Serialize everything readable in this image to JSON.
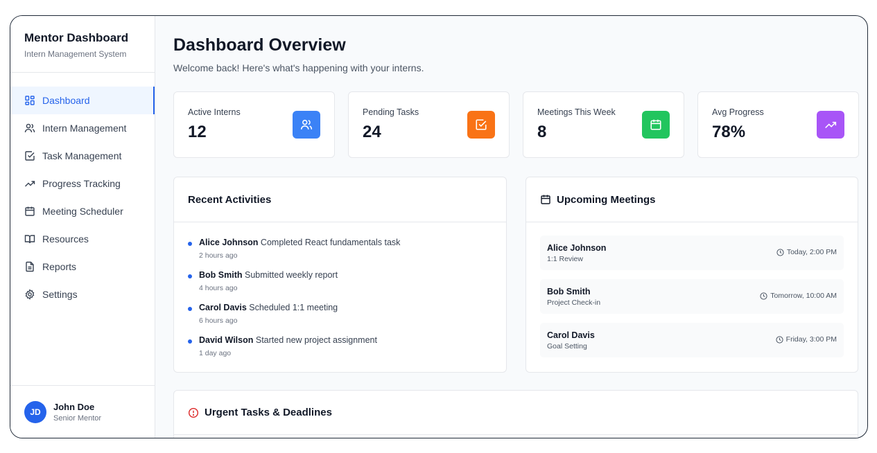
{
  "colors": {
    "accent": "#2563eb",
    "interns_icon_bg": "#3b82f6",
    "tasks_icon_bg": "#f97316",
    "meetings_icon_bg": "#22c55e",
    "progress_icon_bg": "#a855f7",
    "urgent_icon": "#dc2626"
  },
  "sidebar": {
    "title": "Mentor Dashboard",
    "subtitle": "Intern Management System",
    "items": [
      {
        "label": "Dashboard",
        "icon": "grid-icon",
        "active": true
      },
      {
        "label": "Intern Management",
        "icon": "users-icon"
      },
      {
        "label": "Task Management",
        "icon": "checkbox-icon"
      },
      {
        "label": "Progress Tracking",
        "icon": "trending-up-icon"
      },
      {
        "label": "Meeting Scheduler",
        "icon": "calendar-icon"
      },
      {
        "label": "Resources",
        "icon": "book-icon"
      },
      {
        "label": "Reports",
        "icon": "file-text-icon"
      },
      {
        "label": "Settings",
        "icon": "gear-icon"
      }
    ],
    "user": {
      "initials": "JD",
      "name": "John Doe",
      "role": "Senior Mentor"
    }
  },
  "header": {
    "title": "Dashboard Overview",
    "subtitle": "Welcome back! Here's what's happening with your interns."
  },
  "stats": [
    {
      "label": "Active Interns",
      "value": "12",
      "icon": "users-icon"
    },
    {
      "label": "Pending Tasks",
      "value": "24",
      "icon": "checkbox-icon"
    },
    {
      "label": "Meetings This Week",
      "value": "8",
      "icon": "calendar-icon"
    },
    {
      "label": "Avg Progress",
      "value": "78%",
      "icon": "trending-up-icon"
    }
  ],
  "activities": {
    "title": "Recent Activities",
    "items": [
      {
        "name": "Alice Johnson",
        "action": "Completed React fundamentals task",
        "time": "2 hours ago"
      },
      {
        "name": "Bob Smith",
        "action": "Submitted weekly report",
        "time": "4 hours ago"
      },
      {
        "name": "Carol Davis",
        "action": "Scheduled 1:1 meeting",
        "time": "6 hours ago"
      },
      {
        "name": "David Wilson",
        "action": "Started new project assignment",
        "time": "1 day ago"
      }
    ]
  },
  "meetings": {
    "title": "Upcoming Meetings",
    "items": [
      {
        "name": "Alice Johnson",
        "type": "1:1 Review",
        "time": "Today, 2:00 PM"
      },
      {
        "name": "Bob Smith",
        "type": "Project Check-in",
        "time": "Tomorrow, 10:00 AM"
      },
      {
        "name": "Carol Davis",
        "type": "Goal Setting",
        "time": "Friday, 3:00 PM"
      }
    ]
  },
  "urgent": {
    "title": "Urgent Tasks & Deadlines"
  }
}
